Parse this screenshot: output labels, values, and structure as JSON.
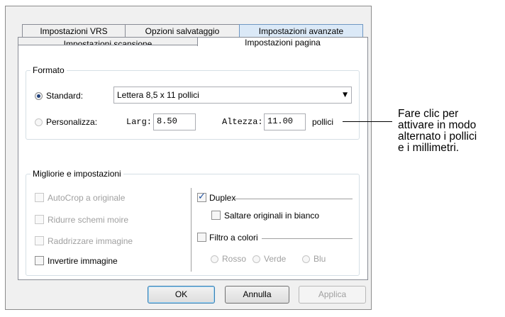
{
  "tabs_top": [
    "Impostazioni VRS",
    "Opzioni salvataggio",
    "Impostazioni avanzate"
  ],
  "tabs_bottom": [
    "Impostazioni scansione",
    "Impostazioni pagina"
  ],
  "formato": {
    "title": "Formato",
    "standard_label": "Standard:",
    "standard_value": "Lettera 8,5 x 11 pollici",
    "custom_label": "Personalizza:",
    "width_label": "Larg:",
    "width_value": "8.50",
    "height_label": "Altezza:",
    "height_value": "11.00",
    "unit_label": "pollici"
  },
  "migliorie": {
    "title": "Migliorie e impostazioni",
    "left_options": [
      "AutoCrop a originale",
      "Ridurre schemi moire",
      "Raddrizzare immagine",
      "Invertire immagine"
    ],
    "duplex_label": "Duplex",
    "skip_blank_label": "Saltare originali in bianco",
    "color_filter_label": "Filtro a colori",
    "colors": [
      "Rosso",
      "Verde",
      "Blu"
    ]
  },
  "buttons": {
    "ok": "OK",
    "cancel": "Annulla",
    "apply": "Applica"
  },
  "callout": {
    "lines": [
      "Fare clic per",
      "attivare in modo",
      "alternato i pollici",
      "e i millimetri."
    ]
  },
  "icons": {
    "dropdown": "chevron-down-icon"
  }
}
